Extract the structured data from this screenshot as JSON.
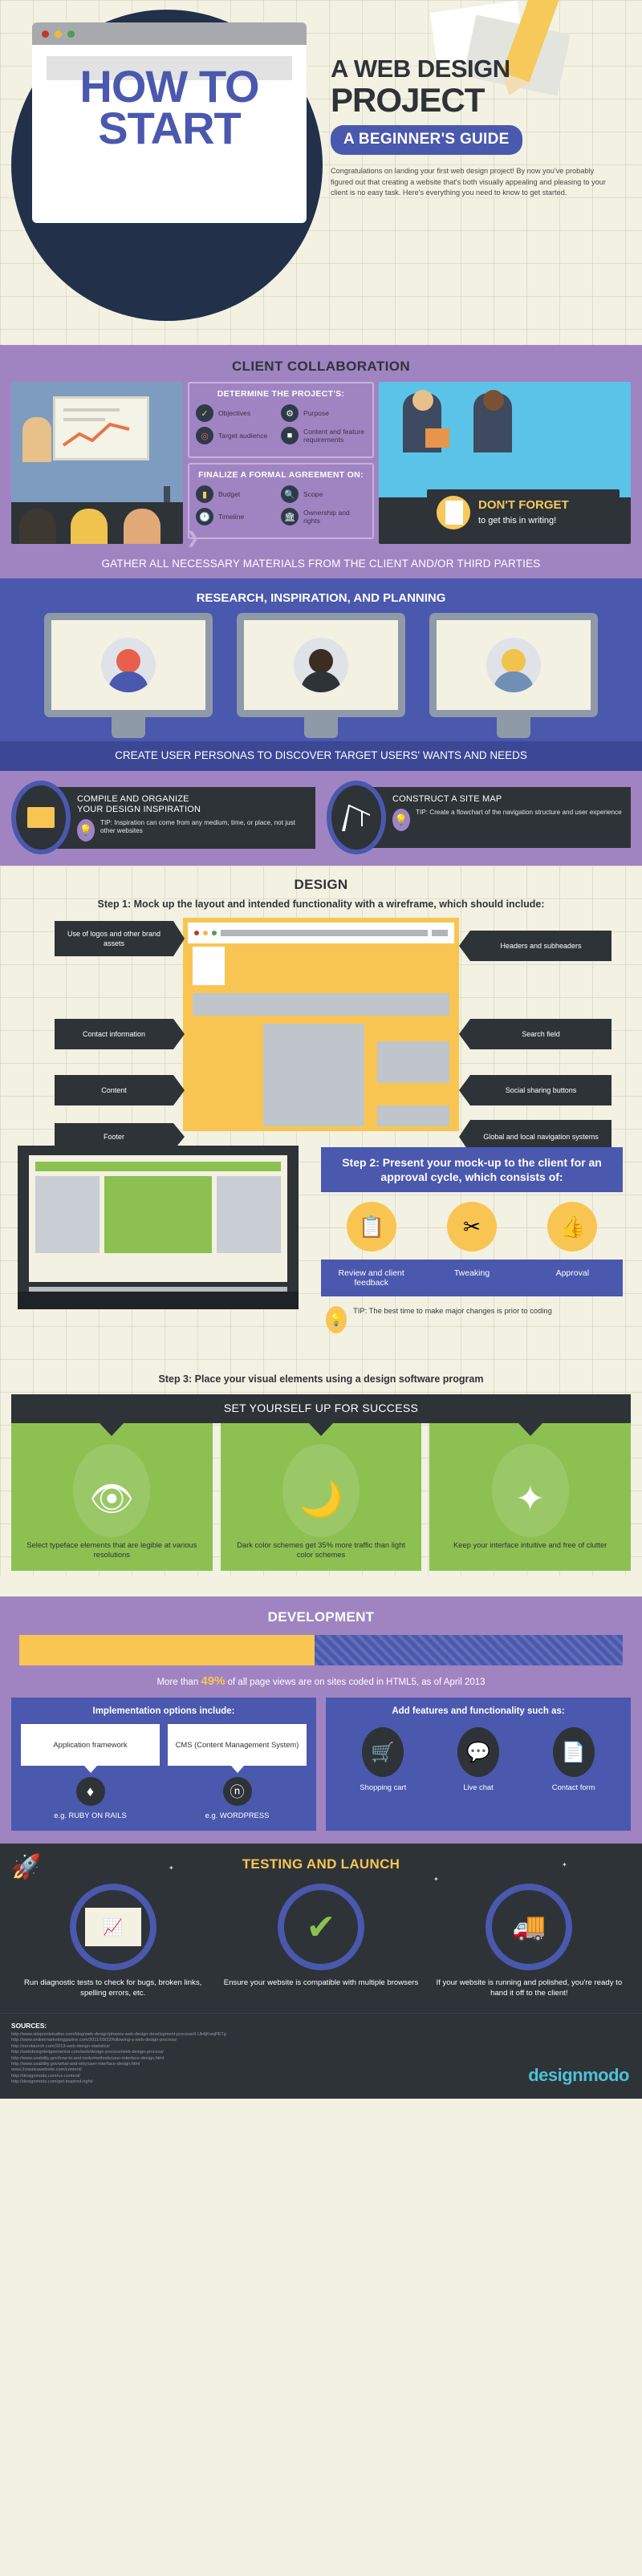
{
  "header": {
    "title_line1": "HOW TO",
    "title_line2": "START",
    "subtitle_line1": "A WEB DESIGN",
    "subtitle_line2": "PROJECT",
    "badge": "A BEGINNER'S GUIDE",
    "intro": "Congratulations on landing your first web design project! By now you've probably figured out that creating a website that's both visually appealing and pleasing to your client is no easy task. Here's everything you need to know to get started."
  },
  "client": {
    "section_title": "CLIENT COLLABORATION",
    "determine_title": "DETERMINE THE PROJECT'S:",
    "determine_items": [
      {
        "label": "Objectives",
        "icon": "checklist-icon"
      },
      {
        "label": "Purpose",
        "icon": "gear-icon"
      },
      {
        "label": "Target audience",
        "icon": "target-icon"
      },
      {
        "label": "Content and feature requirements",
        "icon": "document-icon"
      }
    ],
    "finalize_title": "FINALIZE A FORMAL AGREEMENT ON:",
    "finalize_items": [
      {
        "label": "Budget",
        "icon": "credit-card-icon"
      },
      {
        "label": "Scope",
        "icon": "magnifier-icon"
      },
      {
        "label": "Timeline",
        "icon": "clock-icon"
      },
      {
        "label": "Ownership and rights",
        "icon": "bank-icon"
      }
    ],
    "dont_forget_title": "DON'T FORGET",
    "dont_forget_sub": "to get this in writing!",
    "gather_bar": "GATHER ALL NECESSARY MATERIALS FROM THE CLIENT AND/OR THIRD PARTIES"
  },
  "research": {
    "section_title": "RESEARCH, INSPIRATION, AND PLANNING",
    "persona_bar": "CREATE USER PERSONAS TO DISCOVER TARGET USERS' WANTS AND NEEDS",
    "cards": [
      {
        "heading_line1": "COMPILE AND ORGANIZE",
        "heading_line2": "YOUR DESIGN INSPIRATION",
        "tip": "TIP: Inspiration can come from any medium, time, or place, not just other websites",
        "icon": "folder-icon"
      },
      {
        "heading_line1": "CONSTRUCT A SITE MAP",
        "heading_line2": "",
        "tip": "TIP: Create a flowchart of the navigation structure and user experience",
        "icon": "crane-icon"
      }
    ]
  },
  "design": {
    "section_title": "DESIGN",
    "step1": "Step 1: Mock up the layout and intended functionality with a wireframe, which should include:",
    "tags_left": [
      "Use of logos and other brand assets",
      "Contact information",
      "Content",
      "Footer"
    ],
    "tags_right": [
      "Headers and subheaders",
      "Search field",
      "Social sharing buttons",
      "Global and local navigation systems"
    ],
    "step2_heading": "Step 2: Present your mock-up to the client for an approval cycle, which consists of:",
    "cycle": [
      {
        "label": "Review and client feedback",
        "icon": "clipboard-icon"
      },
      {
        "label": "Tweaking",
        "icon": "scissors-icon"
      },
      {
        "label": "Approval",
        "icon": "thumbs-up-icon"
      }
    ],
    "step2_tip": "TIP: The best time to make major changes is prior to coding",
    "step3": "Step 3: Place your visual elements using a design software program",
    "success_title": "SET YOURSELF UP FOR SUCCESS",
    "success_cards": [
      {
        "text": "Select typeface elements that are legible at various resolutions",
        "icon": "eye-icon"
      },
      {
        "text": "Dark color schemes get 35% more traffic than light color schemes",
        "icon": "moon-icon"
      },
      {
        "text": "Keep your interface intuitive and free of clutter",
        "icon": "sparkle-icon"
      }
    ]
  },
  "development": {
    "section_title": "DEVELOPMENT",
    "stat_prefix": "More than ",
    "stat_value": "49%",
    "stat_suffix": " of all page views are on sites coded in HTML5, as of April 2013",
    "bar_percent": 49,
    "impl_title": "Implementation options include:",
    "impl_options": [
      {
        "bubble": "Application framework",
        "label": "e.g. RUBY ON RAILS",
        "icon": "ruby-gem-icon"
      },
      {
        "bubble": "CMS (Content Management System)",
        "label": "e.g. WORDPRESS",
        "icon": "wordpress-icon"
      }
    ],
    "feat_title": "Add features and functionality such as:",
    "features": [
      {
        "label": "Shopping cart",
        "icon": "shopping-cart-icon"
      },
      {
        "label": "Live chat",
        "icon": "chat-check-icon"
      },
      {
        "label": "Contact form",
        "icon": "contact-form-icon"
      }
    ]
  },
  "testing": {
    "section_title": "TESTING AND LAUNCH",
    "cards": [
      {
        "text": "Run diagnostic tests to check for bugs, broken links, spelling errors, etc.",
        "icon": "chart-screen-icon"
      },
      {
        "text": "Ensure your website is compatible with multiple browsers",
        "icon": "check-circle-icon"
      },
      {
        "text": "If your website is running and polished, you're ready to hand it off to the client!",
        "icon": "delivery-truck-icon"
      }
    ]
  },
  "footer": {
    "sources_heading": "SOURCES:",
    "sources": [
      "http://www.sitepointstudios.com/blog/web-design/phases-web-design-development-process/#.Uk4jKwqPE7g",
      "http://www.onlinemarketinggazine.com/2011/09/22/following-a-web-design-process/",
      "http://zerolaunch.com/2013-web-design-statistics/",
      "http://webdesignledgermentor.com/web/design-process/web-design-process/",
      "http://www.usability.gov/how-to-and-tools/methods/user-interface-design.html",
      "http://www.usability.gov/what-and-why/user-interface-design.html",
      "www.2createawebsite.com/content/",
      "http://designmodo.com/ux-content/",
      "http://designmodo.com/get-inspired-right/"
    ],
    "logo": "designmodo"
  },
  "colors": {
    "cream": "#f2f1e2",
    "purple": "#a084c2",
    "indigo": "#4a58ae",
    "dark": "#2e3338",
    "yellow": "#f9c552",
    "green": "#8cc152",
    "teal": "#4ec2d6"
  }
}
